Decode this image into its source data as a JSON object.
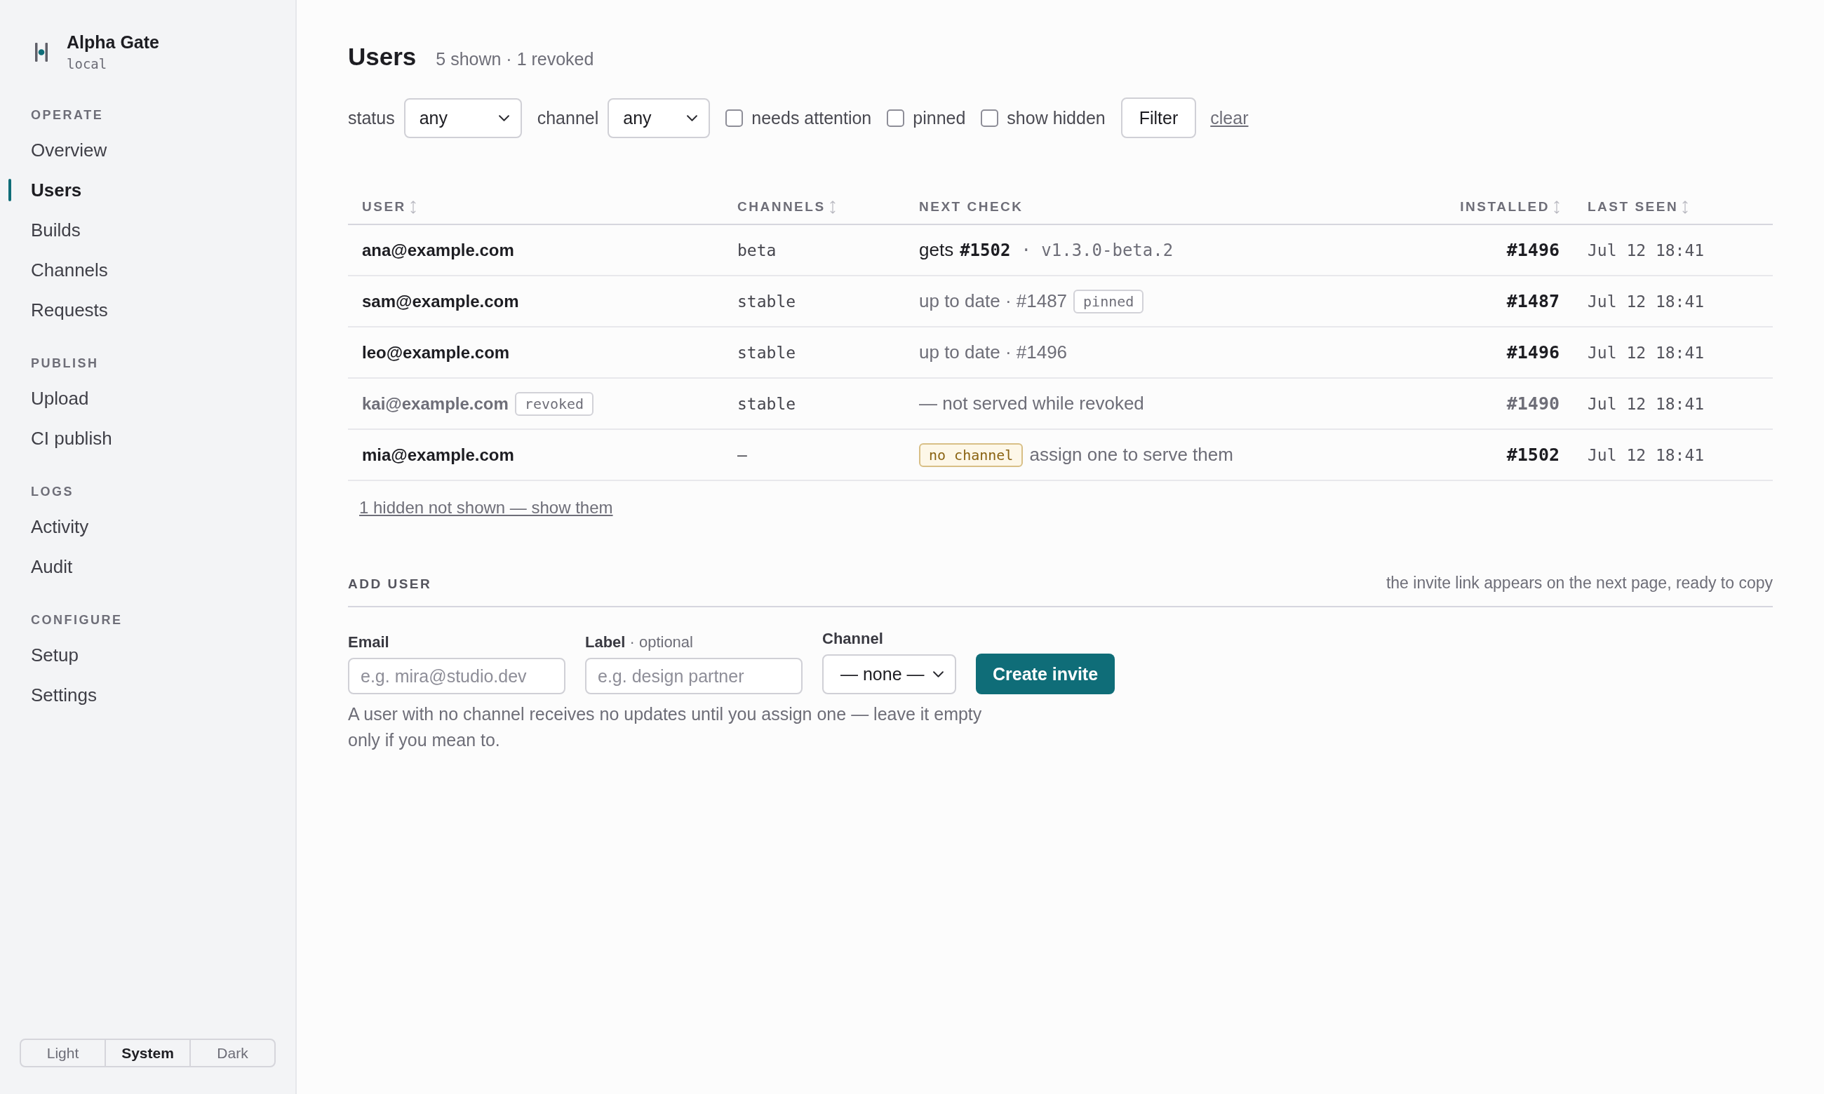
{
  "sidebar": {
    "brand": {
      "name": "Alpha Gate",
      "environment": "local"
    },
    "sections": [
      {
        "heading": "OPERATE",
        "items": [
          {
            "label": "Overview",
            "selected": false
          },
          {
            "label": "Users",
            "selected": true
          },
          {
            "label": "Builds",
            "selected": false
          },
          {
            "label": "Channels",
            "selected": false
          },
          {
            "label": "Requests",
            "selected": false
          }
        ]
      },
      {
        "heading": "PUBLISH",
        "items": [
          {
            "label": "Upload",
            "selected": false
          },
          {
            "label": "CI publish",
            "selected": false
          }
        ]
      },
      {
        "heading": "LOGS",
        "items": [
          {
            "label": "Activity",
            "selected": false
          },
          {
            "label": "Audit",
            "selected": false
          }
        ]
      },
      {
        "heading": "CONFIGURE",
        "items": [
          {
            "label": "Setup",
            "selected": false
          },
          {
            "label": "Settings",
            "selected": false
          }
        ]
      }
    ],
    "theme_switch": [
      {
        "label": "Light",
        "selected": false
      },
      {
        "label": "System",
        "selected": true
      },
      {
        "label": "Dark",
        "selected": false
      }
    ]
  },
  "header": {
    "title": "Users",
    "summary": "5 shown · 1 revoked"
  },
  "filters": {
    "selects": [
      {
        "label": "status",
        "value": "any"
      },
      {
        "label": "channel",
        "value": "any"
      }
    ],
    "checkboxes": [
      {
        "label": "needs attention",
        "checked": false
      },
      {
        "label": "pinned",
        "checked": false
      },
      {
        "label": "show hidden",
        "checked": false
      }
    ],
    "submit": "Filter",
    "clear": "clear"
  },
  "table": {
    "columns": [
      {
        "label": "USER",
        "sortable": true
      },
      {
        "label": "CHANNELS",
        "sortable": true
      },
      {
        "label": "NEXT CHECK",
        "sortable": false
      },
      {
        "label": "INSTALLED",
        "sortable": true
      },
      {
        "label": "LAST SEEN",
        "sortable": true
      }
    ],
    "rows": [
      {
        "user": "ana@example.com",
        "revoked": false,
        "channel": "beta",
        "next_check": {
          "kind": "update",
          "text": "gets",
          "build": "#1502",
          "version": "· v1.3.0-beta.2"
        },
        "installed": "#1496",
        "last_seen": "Jul 12 18:41"
      },
      {
        "user": "sam@example.com",
        "revoked": false,
        "channel": "stable",
        "next_check": {
          "kind": "current",
          "text": "up to date · #1487",
          "badge": "pinned"
        },
        "installed": "#1487",
        "last_seen": "Jul 12 18:41"
      },
      {
        "user": "leo@example.com",
        "revoked": false,
        "channel": "stable",
        "next_check": {
          "kind": "current",
          "text": "up to date · #1496"
        },
        "installed": "#1496",
        "last_seen": "Jul 12 18:41"
      },
      {
        "user": "kai@example.com",
        "revoked": true,
        "badge": "revoked",
        "channel": "stable",
        "next_check": {
          "kind": "blocked",
          "text": "— not served while revoked"
        },
        "installed": "#1490",
        "last_seen": "Jul 12 18:41"
      },
      {
        "user": "mia@example.com",
        "revoked": false,
        "channel": "–",
        "next_check": {
          "kind": "unassigned",
          "badge": "no channel",
          "text": "assign one to serve them"
        },
        "installed": "#1502",
        "last_seen": "Jul 12 18:41"
      }
    ],
    "hidden_link": "1 hidden not shown — show them"
  },
  "add_user": {
    "heading": "ADD USER",
    "note": "the invite link appears on the next page, ready to copy",
    "fields": [
      {
        "kind": "input",
        "label": "Email",
        "placeholder": "e.g. mira@studio.dev"
      },
      {
        "kind": "input",
        "label": "Label",
        "hint": "· optional",
        "placeholder": "e.g. design partner"
      },
      {
        "kind": "select",
        "label": "Channel",
        "value": "— none —"
      }
    ],
    "submit": "Create invite",
    "help": "A user with no channel receives no updates until you assign one — leave it empty only if you mean to."
  }
}
